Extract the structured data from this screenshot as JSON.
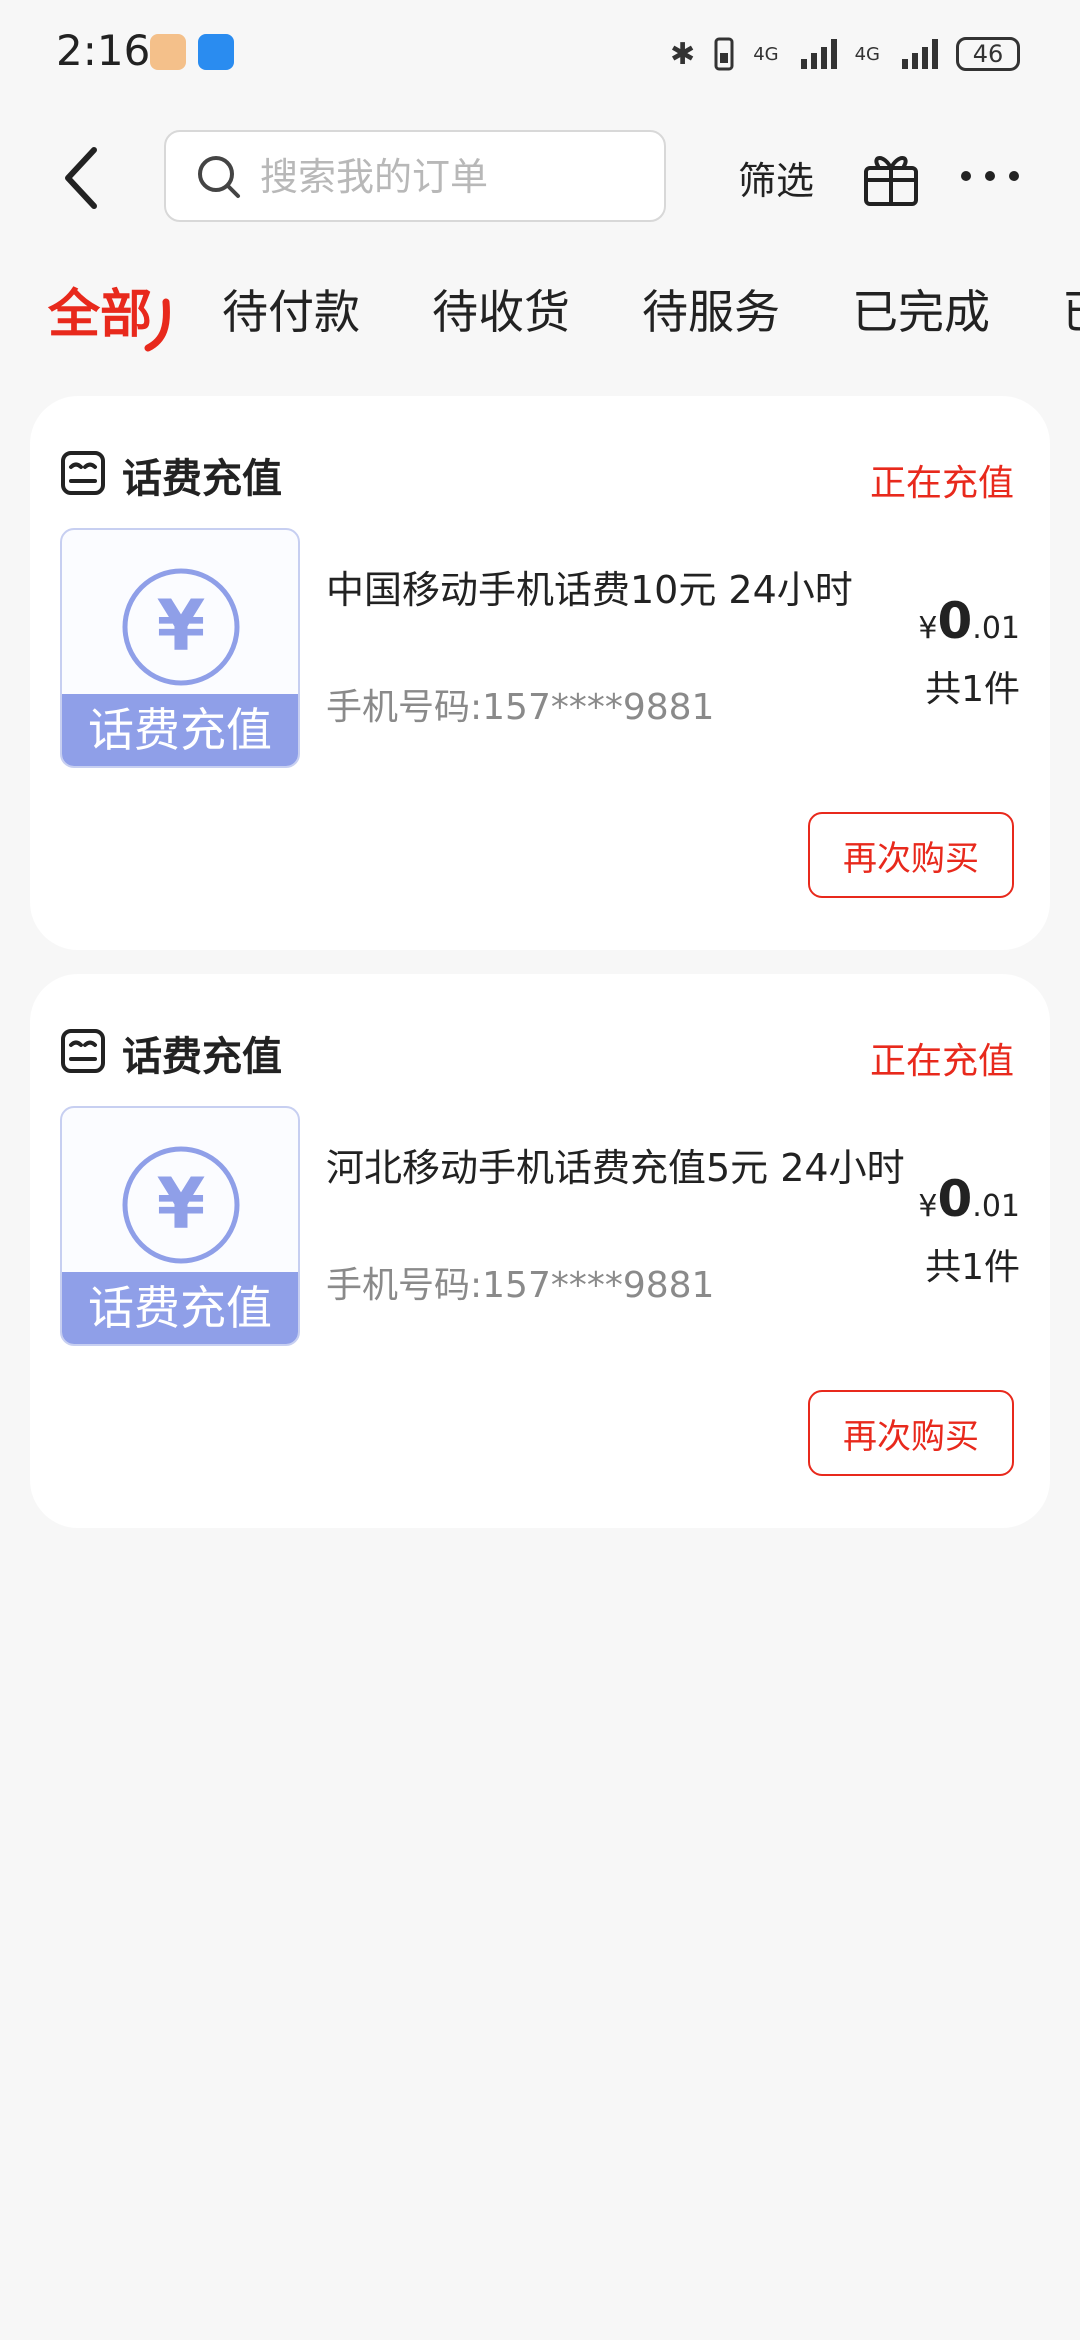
{
  "status_bar": {
    "time": "2:16",
    "network_1": "4G",
    "network_2": "4G",
    "battery": "46",
    "bluetooth_symbol": "✱"
  },
  "top_bar": {
    "search_placeholder": "搜索我的订单",
    "search_value": "",
    "filter_label": "筛选"
  },
  "tabs": [
    {
      "label": "全部",
      "active": true
    },
    {
      "label": "待付款",
      "active": false
    },
    {
      "label": "待收货",
      "active": false
    },
    {
      "label": "待服务",
      "active": false
    },
    {
      "label": "已完成",
      "active": false
    },
    {
      "label": "已",
      "active": false
    }
  ],
  "orders": [
    {
      "category": "话费充值",
      "status": "正在充值",
      "thumb_label": "话费充值",
      "thumb_symbol": "¥",
      "title": "中国移动手机话费10元 24小时",
      "subtitle": "手机号码:157****9881",
      "price_symbol": "¥",
      "price_int": "0",
      "price_dec": ".01",
      "quantity": "共1件",
      "rebuy_label": "再次购买"
    },
    {
      "category": "话费充值",
      "status": "正在充值",
      "thumb_label": "话费充值",
      "thumb_symbol": "¥",
      "title": "河北移动手机话费充值5元 24小时",
      "subtitle": "手机号码:157****9881",
      "price_symbol": "¥",
      "price_int": "0",
      "price_dec": ".01",
      "quantity": "共1件",
      "rebuy_label": "再次购买"
    }
  ],
  "colors": {
    "accent_red": "#e8291c",
    "thumb_blue": "#8f9fe8",
    "background": "#f7f7f7"
  }
}
